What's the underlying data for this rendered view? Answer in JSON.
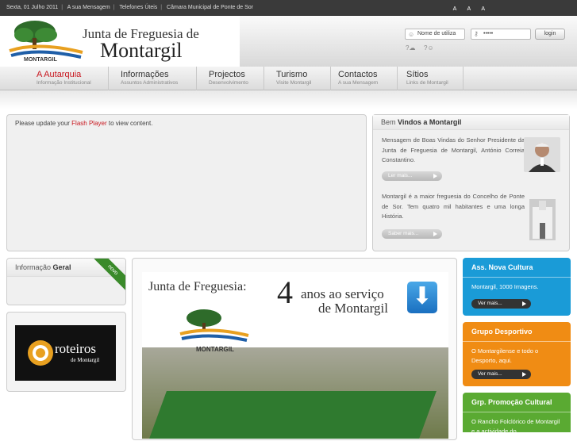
{
  "topbar": {
    "date": "Sexta, 01 Julho 2011",
    "links": [
      "A sua Mensagem",
      "Telefones Úteis",
      "Câmara Municipal de Ponte de Sor"
    ],
    "font_sizes": "A A A"
  },
  "logo": {
    "line1": "Junta de Freguesia de",
    "line2": "Montargil",
    "mark": "MONTARGIL"
  },
  "login": {
    "user_placeholder": "Nome de utiliza",
    "password_value": "•••••",
    "button": "login"
  },
  "nav": [
    {
      "label": "A Autarquia",
      "sub": "Informação Institucional"
    },
    {
      "label": "Informações",
      "sub": "Assuntos Administrativos"
    },
    {
      "label": "Projectos",
      "sub": "Desenvolvimento"
    },
    {
      "label": "Turismo",
      "sub": "Visite Montargil"
    },
    {
      "label": "Contactos",
      "sub": "A sua Mensagem"
    },
    {
      "label": "Sítios",
      "sub": "Links de Montargil"
    }
  ],
  "flash": {
    "pre": "Please update your",
    "link": "Flash Player",
    "post": "to view content."
  },
  "welcome": {
    "title_pre": "Bem",
    "title_bold": "Vindos a Montargil",
    "p1": "Mensagem de Boas Vindas do Senhor Presidente da Junta de Freguesia de Montargil, António Correia Constantino.",
    "b1": "Ler mais...",
    "p2": "Montargil é a maior freguesia do Concelho de Ponte de Sor. Tem quatro mil habitantes e uma longa História.",
    "b2": "Saber mais..."
  },
  "info": {
    "title_pre": "Informação",
    "title_bold": "Geral",
    "ribbon": "novo"
  },
  "roteiros": {
    "l1": "roteiros",
    "l2": "de Montargil"
  },
  "feature": {
    "l1": "Junta de Freguesia:",
    "num": "4",
    "l2": "anos ao serviço",
    "l3": "de Montargil"
  },
  "boxes": [
    {
      "title": "Ass. Nova Cultura",
      "text": "Montargil, 1000 Imagens.",
      "btn": "Ver mais...",
      "color": "#1a9bd7"
    },
    {
      "title": "Grupo Desportivo",
      "text": "O Montargilense e todo o Desporto, aqui.",
      "btn": "Ver mais...",
      "color": "#f08c14"
    },
    {
      "title": "Grp. Promoção Cultural",
      "text": "O Rancho Folclórico de Montargil e a actividade do",
      "btn": "",
      "color": "#5aaa32"
    }
  ]
}
